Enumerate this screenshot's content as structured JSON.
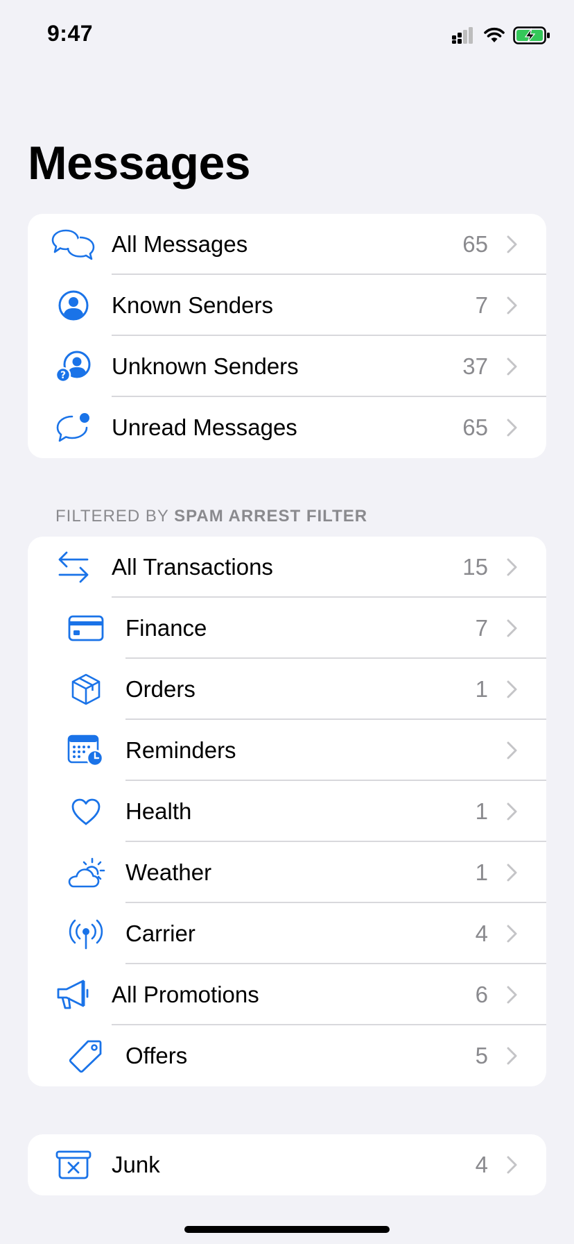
{
  "status_bar": {
    "time": "9:47"
  },
  "header": {
    "title": "Messages"
  },
  "colors": {
    "accent": "#1a73e8",
    "background": "#f2f2f7",
    "count": "#8a8a8e",
    "battery": "#34c759"
  },
  "groups": {
    "main": [
      {
        "label": "All Messages",
        "count": "65",
        "icon": "chat-bubbles-icon"
      },
      {
        "label": "Known Senders",
        "count": "7",
        "icon": "person-circle-icon"
      },
      {
        "label": "Unknown Senders",
        "count": "37",
        "icon": "person-question-icon"
      },
      {
        "label": "Unread Messages",
        "count": "65",
        "icon": "chat-unread-icon"
      }
    ],
    "filtered_header": {
      "prefix": "FILTERED BY",
      "filter_name": "SPAM ARREST FILTER"
    },
    "filtered": [
      {
        "label": "All Transactions",
        "count": "15",
        "icon": "arrows-left-right-icon"
      },
      {
        "label": "Finance",
        "count": "7",
        "icon": "credit-card-icon"
      },
      {
        "label": "Orders",
        "count": "1",
        "icon": "shipping-box-icon"
      },
      {
        "label": "Reminders",
        "count": "",
        "icon": "calendar-clock-icon"
      },
      {
        "label": "Health",
        "count": "1",
        "icon": "heart-icon"
      },
      {
        "label": "Weather",
        "count": "1",
        "icon": "cloud-sun-icon"
      },
      {
        "label": "Carrier",
        "count": "4",
        "icon": "antenna-icon"
      },
      {
        "label": "All Promotions",
        "count": "6",
        "icon": "megaphone-icon"
      },
      {
        "label": "Offers",
        "count": "5",
        "icon": "tag-icon"
      }
    ],
    "junk": [
      {
        "label": "Junk",
        "count": "4",
        "icon": "junk-bin-icon"
      }
    ]
  }
}
